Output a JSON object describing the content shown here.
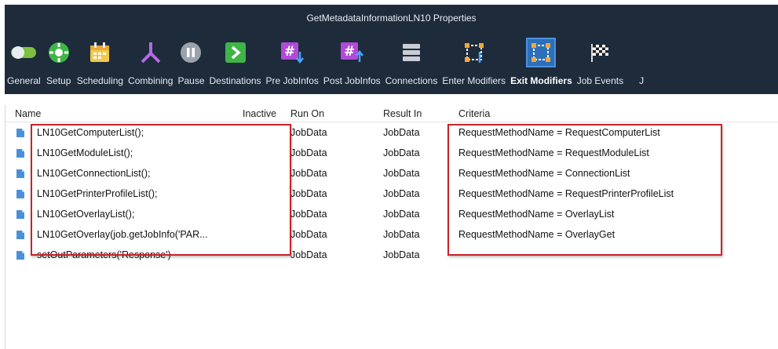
{
  "window": {
    "title": "GetMetadataInformationLN10 Properties"
  },
  "toolbar": {
    "items": [
      {
        "label": "General",
        "icon": "toggle-icon"
      },
      {
        "label": "Setup",
        "icon": "setup-gear-icon"
      },
      {
        "label": "Scheduling",
        "icon": "calendar-icon"
      },
      {
        "label": "Combining",
        "icon": "merge-icon"
      },
      {
        "label": "Pause",
        "icon": "pause-icon"
      },
      {
        "label": "Destinations",
        "icon": "arrow-right-icon"
      },
      {
        "label": "Pre JobInfos",
        "icon": "hash-down-icon"
      },
      {
        "label": "Post JobInfos",
        "icon": "hash-up-icon"
      },
      {
        "label": "Connections",
        "icon": "stack-icon"
      },
      {
        "label": "Enter Modifiers",
        "icon": "enter-modifier-icon"
      },
      {
        "label": "Exit Modifiers",
        "icon": "exit-modifier-icon",
        "active": true
      },
      {
        "label": "Job Events",
        "icon": "checkered-flag-icon"
      },
      {
        "label": "J",
        "icon": ""
      }
    ]
  },
  "table": {
    "columns": [
      "Name",
      "Inactive",
      "Run On",
      "Result In",
      "Criteria"
    ],
    "rows": [
      {
        "name": "LN10GetComputerList();",
        "inactive": "",
        "run_on": "JobData",
        "result_in": "JobData",
        "criteria": "RequestMethodName = RequestComputerList"
      },
      {
        "name": "LN10GetModuleList();",
        "inactive": "",
        "run_on": "JobData",
        "result_in": "JobData",
        "criteria": "RequestMethodName = RequestModuleList"
      },
      {
        "name": "LN10GetConnectionList();",
        "inactive": "",
        "run_on": "JobData",
        "result_in": "JobData",
        "criteria": "RequestMethodName = ConnectionList"
      },
      {
        "name": "LN10GetPrinterProfileList();",
        "inactive": "",
        "run_on": "JobData",
        "result_in": "JobData",
        "criteria": "RequestMethodName = RequestPrinterProfileList"
      },
      {
        "name": "LN10GetOverlayList();",
        "inactive": "",
        "run_on": "JobData",
        "result_in": "JobData",
        "criteria": "RequestMethodName = OverlayList"
      },
      {
        "name": "LN10GetOverlay(job.getJobInfo('PAR...",
        "inactive": "",
        "run_on": "JobData",
        "result_in": "JobData",
        "criteria": "RequestMethodName = OverlayGet"
      },
      {
        "name": "setOutParameters('Response')",
        "inactive": "",
        "run_on": "JobData",
        "result_in": "JobData",
        "criteria": ""
      }
    ]
  },
  "colors": {
    "titlebar": "#1e2b3b",
    "highlight": "#c8232c",
    "active_tool": "#2d6fb8"
  }
}
